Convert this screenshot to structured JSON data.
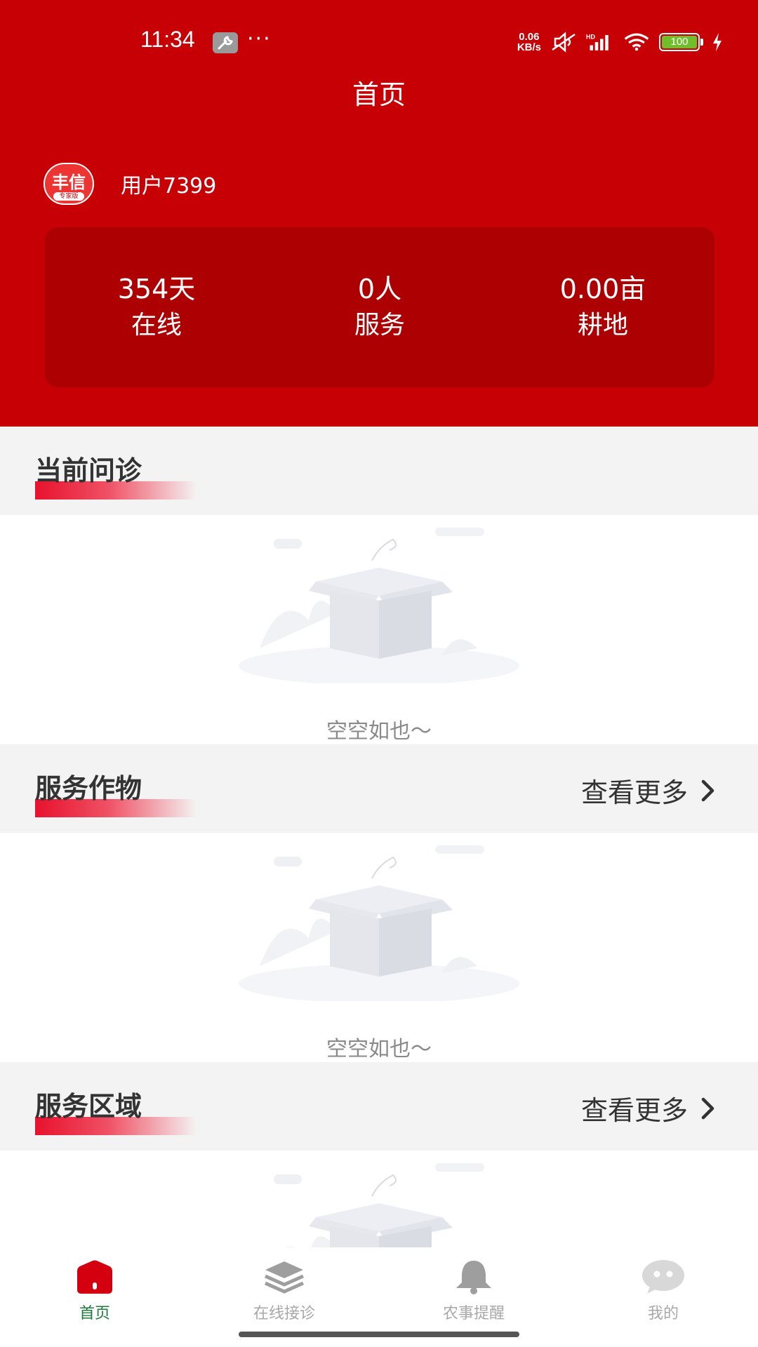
{
  "status": {
    "time": "11:34",
    "more": "···",
    "netspeed_value": "0.06",
    "netspeed_unit": "KB/s",
    "signal_label": "HD",
    "battery": "100"
  },
  "header": {
    "title": "首页"
  },
  "user": {
    "logo_text": "丰信",
    "logo_sub": "专家版",
    "name": "用户7399"
  },
  "stats": [
    {
      "value": "354天",
      "label": "在线"
    },
    {
      "value": "0人",
      "label": "服务"
    },
    {
      "value": "0.00亩",
      "label": "耕地"
    }
  ],
  "sections": {
    "consultation": {
      "title": "当前问诊",
      "empty": "空空如也～"
    },
    "crops": {
      "title": "服务作物",
      "more": "查看更多",
      "empty": "空空如也～"
    },
    "region": {
      "title": "服务区域",
      "more": "查看更多"
    }
  },
  "nav": {
    "items": [
      {
        "label": "首页",
        "icon": "home-icon",
        "active": true
      },
      {
        "label": "在线接诊",
        "icon": "layers-icon",
        "active": false
      },
      {
        "label": "农事提醒",
        "icon": "bell-icon",
        "active": false
      },
      {
        "label": "我的",
        "icon": "chat-bubble-icon",
        "active": false
      }
    ]
  },
  "colors": {
    "primary_red": "#c70006",
    "card_red": "#ad0003",
    "active_nav": "#1e7a3c",
    "inactive_nav": "#a8a8a8"
  }
}
